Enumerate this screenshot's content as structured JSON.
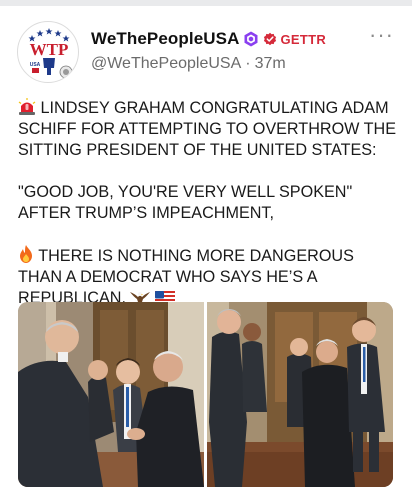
{
  "post": {
    "display_name": "WeThePeopleUSA",
    "brand_label": "GETTR",
    "handle": "@WeThePeopleUSA",
    "separator": "·",
    "time_ago": "37m",
    "more_label": "···",
    "avatar_logo_text": "WTP",
    "avatar_logo_sub": "USA",
    "lines": [
      "LINDSEY GRAHAM CONGRATULATING ADAM SCHIFF FOR ATTEMPTING TO OVERTHROW THE SITTING PRESIDENT OF THE UNITED STATES:",
      "\"GOOD JOB, YOU'RE VERY WELL SPOKEN\" AFTER TRUMP’S IMPEACHMENT,",
      "THERE IS NOTHING MORE DANGEROUS THAN A DEMOCRAT WHO SAYS HE’S A REPUBLICAN."
    ],
    "icons": {
      "verified": "verified-badge-icon",
      "brand": "gettr-badge-icon",
      "siren": "siren-icon",
      "fire": "fire-icon",
      "eagle": "eagle-icon",
      "flag": "us-flag-icon"
    },
    "colors": {
      "brand": "#d52a3a",
      "verified": "#8a3ff0"
    }
  }
}
